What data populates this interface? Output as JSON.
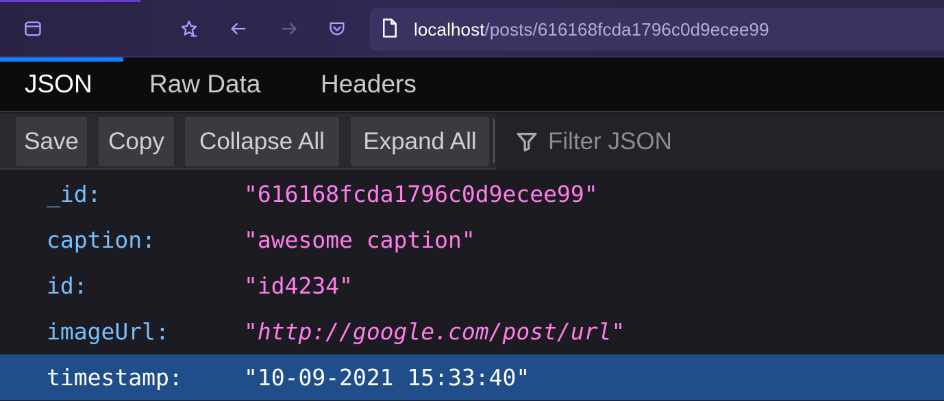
{
  "browser": {
    "url_host": "localhost",
    "url_path": "/posts/616168fcda1796c0d9ecee99"
  },
  "tabs": [
    {
      "label": "JSON",
      "active": true
    },
    {
      "label": "Raw Data",
      "active": false
    },
    {
      "label": "Headers",
      "active": false
    }
  ],
  "toolbar": {
    "save_label": "Save",
    "copy_label": "Copy",
    "collapse_label": "Collapse All",
    "expand_label": "Expand All",
    "filter_placeholder": "Filter JSON"
  },
  "json_rows": [
    {
      "key": "_id:",
      "value": "616168fcda1796c0d9ecee99",
      "is_link": false,
      "selected": false
    },
    {
      "key": "caption:",
      "value": "awesome caption",
      "is_link": false,
      "selected": false
    },
    {
      "key": "id:",
      "value": "id4234",
      "is_link": false,
      "selected": false
    },
    {
      "key": "imageUrl:",
      "value": "http://google.com/post/url",
      "is_link": true,
      "selected": false
    },
    {
      "key": "timestamp:",
      "value": "10-09-2021 15:33:40",
      "is_link": false,
      "selected": true
    }
  ],
  "colors": {
    "key": "#75bfff",
    "string_value": "#ff7de9",
    "selected_row": "#204e8a",
    "tab_indicator": "#0a84ff"
  },
  "icons": {
    "sidebar": "sidebar-icon",
    "bookmark": "star-icon",
    "back": "back-arrow-icon",
    "forward": "forward-arrow-icon",
    "pocket": "pocket-icon",
    "page": "page-icon",
    "filter": "filter-icon"
  }
}
